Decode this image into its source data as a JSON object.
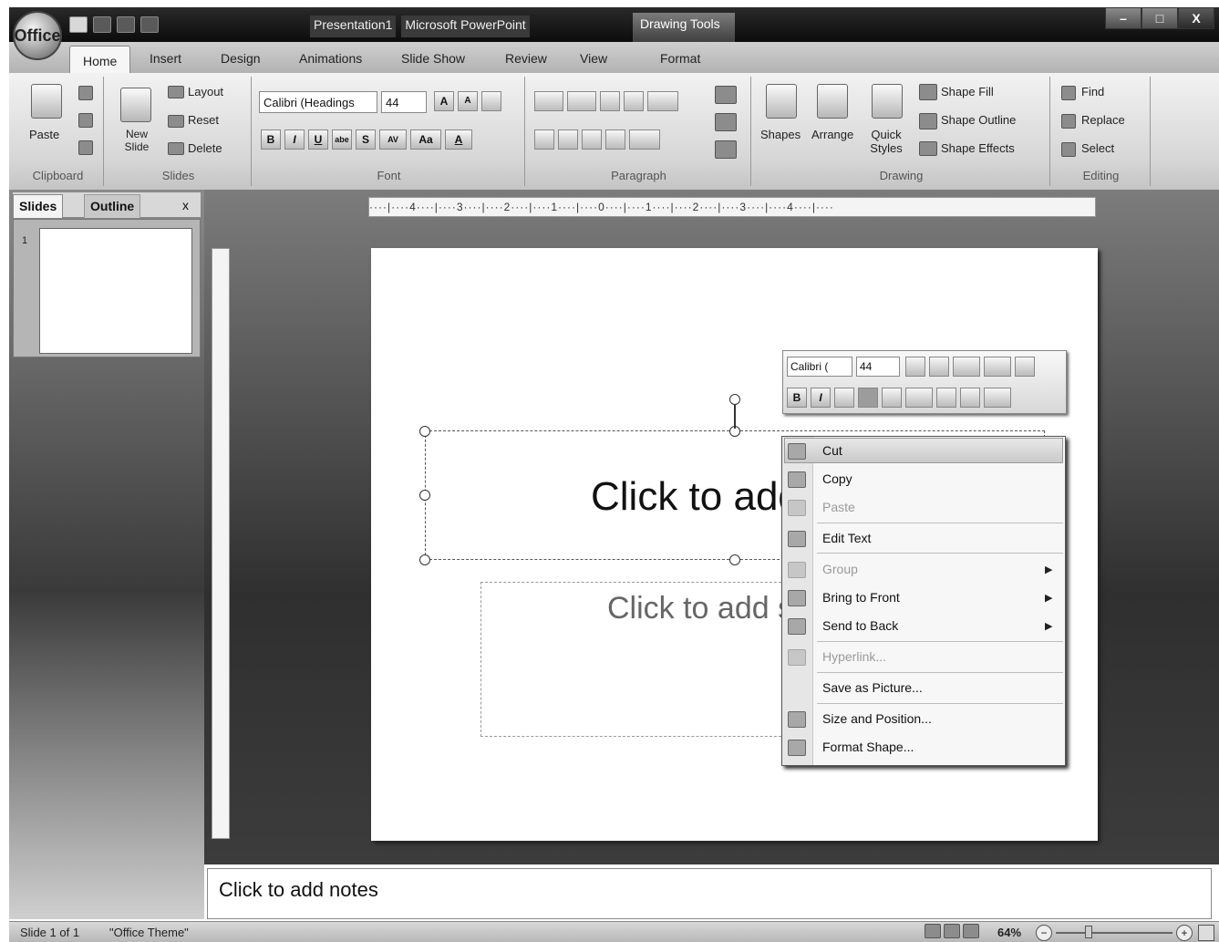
{
  "titlebar": {
    "document": "Presentation1",
    "app": "Microsoft PowerPoint",
    "contextual_tab_group": "Drawing Tools",
    "office_logo": "Office",
    "minimize": "–",
    "maximize": "□",
    "close": "X"
  },
  "tabs": [
    "Home",
    "Insert",
    "Design",
    "Animations",
    "Slide Show",
    "Review",
    "View",
    "Format"
  ],
  "ribbon": {
    "clipboard": {
      "label": "Clipboard",
      "paste": "Paste"
    },
    "slides": {
      "label": "Slides",
      "new_slide": "New Slide",
      "layout": "Layout",
      "reset": "Reset",
      "delete": "Delete"
    },
    "font": {
      "label": "Font",
      "font_name": "Calibri (Headings",
      "font_size": "44",
      "grow": "A",
      "shrink": "A",
      "bold": "B",
      "italic": "I",
      "underline": "U",
      "strike": "abe",
      "shadow": "S",
      "spacing": "AV",
      "case": "Aa",
      "color": "A"
    },
    "paragraph": {
      "label": "Paragraph"
    },
    "drawing": {
      "label": "Drawing",
      "shapes": "Shapes",
      "arrange": "Arrange",
      "quick_styles": "Quick Styles",
      "shape_fill": "Shape Fill",
      "shape_outline": "Shape Outline",
      "shape_effects": "Shape Effects"
    },
    "editing": {
      "label": "Editing",
      "find": "Find",
      "replace": "Replace",
      "select": "Select"
    }
  },
  "left_pane": {
    "tab_slides": "Slides",
    "tab_outline": "Outline",
    "close": "x",
    "slide_number": "1"
  },
  "ruler": {
    "marks": "····|····4····|····3····|····2····|····1····|····0····|····1····|····2····|····3····|····4····|····"
  },
  "slide": {
    "title_placeholder": "Click to add",
    "subtitle_placeholder": "Click to add s"
  },
  "mini_toolbar": {
    "font": "Calibri (",
    "size": "44",
    "bold": "B",
    "italic": "I"
  },
  "context_menu": {
    "items": [
      {
        "label": "Cut",
        "disabled": false
      },
      {
        "label": "Copy",
        "disabled": false
      },
      {
        "label": "Paste",
        "disabled": true
      },
      {
        "label": "Edit Text",
        "disabled": false
      },
      {
        "label": "Group",
        "disabled": true
      },
      {
        "label": "Bring to Front",
        "disabled": false
      },
      {
        "label": "Send to Back",
        "disabled": false
      },
      {
        "label": "Hyperlink...",
        "disabled": true
      },
      {
        "label": "Save as Picture...",
        "disabled": false
      },
      {
        "label": "Size and Position...",
        "disabled": false
      },
      {
        "label": "Format Shape...",
        "disabled": false
      }
    ]
  },
  "notes": {
    "placeholder": "Click to add notes"
  },
  "status": {
    "slide": "Slide 1 of 1",
    "theme": "\"Office Theme\"",
    "zoom": "64%"
  }
}
